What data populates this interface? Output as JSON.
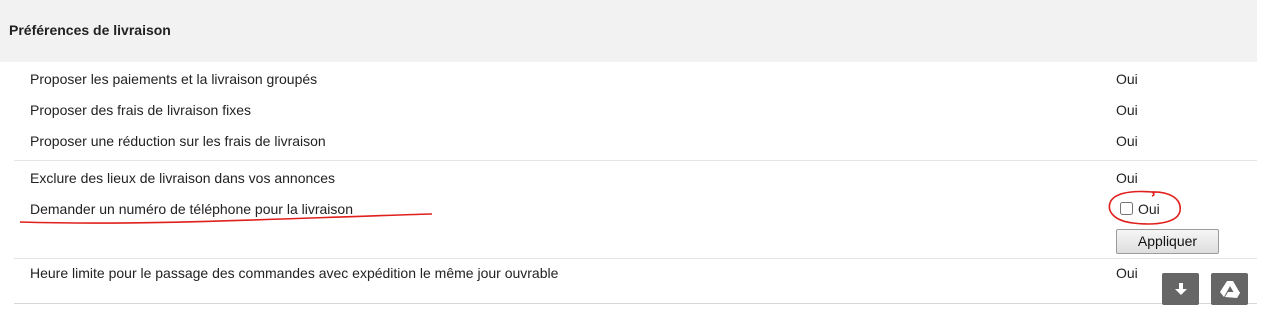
{
  "section": {
    "title": "Préférences de livraison"
  },
  "rows": [
    {
      "label": "Proposer les paiements et la livraison groupés",
      "value": "Oui"
    },
    {
      "label": "Proposer des frais de livraison fixes",
      "value": "Oui"
    },
    {
      "label": "Proposer une réduction sur les frais de livraison",
      "value": "Oui"
    },
    {
      "label": "Exclure des lieux de livraison dans vos annonces",
      "value": "Oui"
    },
    {
      "label": "Demander un numéro de téléphone pour la livraison",
      "checkbox_label": "Oui",
      "checked": false,
      "button_label": "Appliquer"
    },
    {
      "label": "Heure limite pour le passage des commandes avec expédition le même jour ouvrable",
      "value": "Oui"
    }
  ],
  "floating_buttons": {
    "download_icon": "arrow-down-icon",
    "drive_icon": "google-drive-icon"
  },
  "colors": {
    "header_bg": "#f2f2f2",
    "annotation": "#e0201c",
    "icon_button_bg": "#666666"
  }
}
